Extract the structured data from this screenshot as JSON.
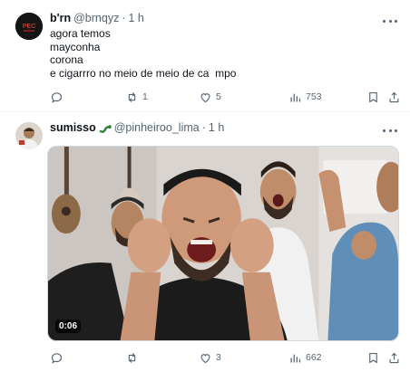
{
  "tweets": [
    {
      "author": {
        "name": "b'rn",
        "handle": "@brnqyz",
        "time": "1 h"
      },
      "text_lines": [
        "agora temos",
        "mayconha",
        "corona",
        "e cigarrro no meio de meio de ca  mpo"
      ],
      "stats": {
        "reposts": "1",
        "likes": "5",
        "views": "753",
        "replies": ""
      }
    },
    {
      "author": {
        "name": "sumisso",
        "handle": "@pinheiroo_lima",
        "time": "1 h"
      },
      "media": {
        "duration": "0:06"
      },
      "stats": {
        "reposts": "",
        "likes": "3",
        "views": "662",
        "replies": ""
      }
    }
  ],
  "separator": "·",
  "icons": [
    "more-icon",
    "reply-icon",
    "repost-icon",
    "like-icon",
    "views-icon",
    "bookmark-icon",
    "share-icon",
    "snake-emoji-icon"
  ],
  "colors": {
    "text": "#0f1419",
    "secondary": "#536471",
    "border": "#eff3f4"
  }
}
